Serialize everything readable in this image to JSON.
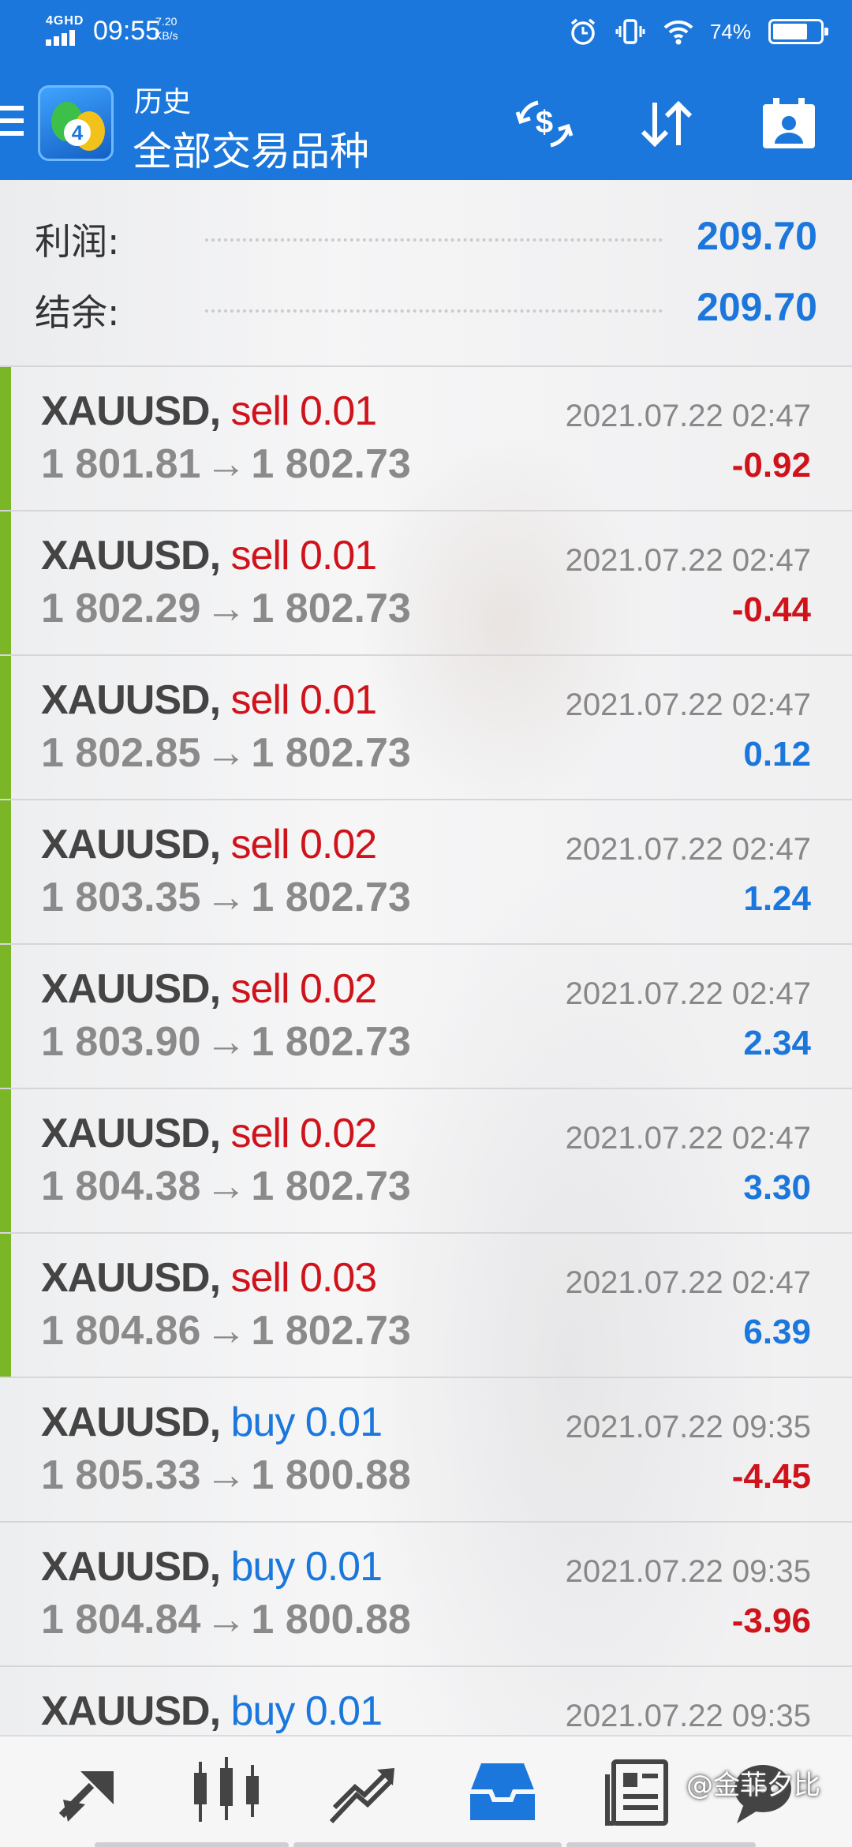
{
  "status_bar": {
    "network": "4GHD",
    "time": "09:55",
    "speed_value": "7.20",
    "speed_unit": "KB/s",
    "battery_percent": "74%",
    "battery_level": 0.74
  },
  "header": {
    "subtitle": "历史",
    "title": "全部交易品种",
    "icons": [
      "menu-icon",
      "app-logo",
      "currency-exchange-icon",
      "sort-icon",
      "calendar-person-icon"
    ]
  },
  "summary": {
    "profit_label": "利润:",
    "profit_value": "209.70",
    "balance_label": "结余:",
    "balance_value": "209.70"
  },
  "trades": [
    {
      "symbol": "XAUUSD,",
      "side": "sell",
      "lots": "0.01",
      "open": "1 801.81",
      "arrow": "→",
      "close": "1 802.73",
      "time": "2021.07.22 02:47",
      "profit": "-0.92"
    },
    {
      "symbol": "XAUUSD,",
      "side": "sell",
      "lots": "0.01",
      "open": "1 802.29",
      "arrow": "→",
      "close": "1 802.73",
      "time": "2021.07.22 02:47",
      "profit": "-0.44"
    },
    {
      "symbol": "XAUUSD,",
      "side": "sell",
      "lots": "0.01",
      "open": "1 802.85",
      "arrow": "→",
      "close": "1 802.73",
      "time": "2021.07.22 02:47",
      "profit": "0.12"
    },
    {
      "symbol": "XAUUSD,",
      "side": "sell",
      "lots": "0.02",
      "open": "1 803.35",
      "arrow": "→",
      "close": "1 802.73",
      "time": "2021.07.22 02:47",
      "profit": "1.24"
    },
    {
      "symbol": "XAUUSD,",
      "side": "sell",
      "lots": "0.02",
      "open": "1 803.90",
      "arrow": "→",
      "close": "1 802.73",
      "time": "2021.07.22 02:47",
      "profit": "2.34"
    },
    {
      "symbol": "XAUUSD,",
      "side": "sell",
      "lots": "0.02",
      "open": "1 804.38",
      "arrow": "→",
      "close": "1 802.73",
      "time": "2021.07.22 02:47",
      "profit": "3.30"
    },
    {
      "symbol": "XAUUSD,",
      "side": "sell",
      "lots": "0.03",
      "open": "1 804.86",
      "arrow": "→",
      "close": "1 802.73",
      "time": "2021.07.22 02:47",
      "profit": "6.39"
    },
    {
      "symbol": "XAUUSD,",
      "side": "buy",
      "lots": "0.01",
      "open": "1 805.33",
      "arrow": "→",
      "close": "1 800.88",
      "time": "2021.07.22 09:35",
      "profit": "-4.45"
    },
    {
      "symbol": "XAUUSD,",
      "side": "buy",
      "lots": "0.01",
      "open": "1 804.84",
      "arrow": "→",
      "close": "1 800.88",
      "time": "2021.07.22 09:35",
      "profit": "-3.96"
    },
    {
      "symbol": "XAUUSD,",
      "side": "buy",
      "lots": "0.01",
      "open": "",
      "arrow": "",
      "close": "",
      "time": "2021.07.22 09:35",
      "profit": ""
    }
  ],
  "bottom_nav": {
    "tabs": [
      "quotes-icon",
      "chart-icon",
      "trade-icon",
      "history-icon",
      "news-icon",
      "chat-icon"
    ],
    "active": "history-icon",
    "watermark": "@金菲夕比"
  },
  "colors": {
    "header_blue": "#1b77dc",
    "sell_red": "#d0131b",
    "buy_blue": "#1b77dc",
    "sell_marker_green": "#7ab626"
  }
}
